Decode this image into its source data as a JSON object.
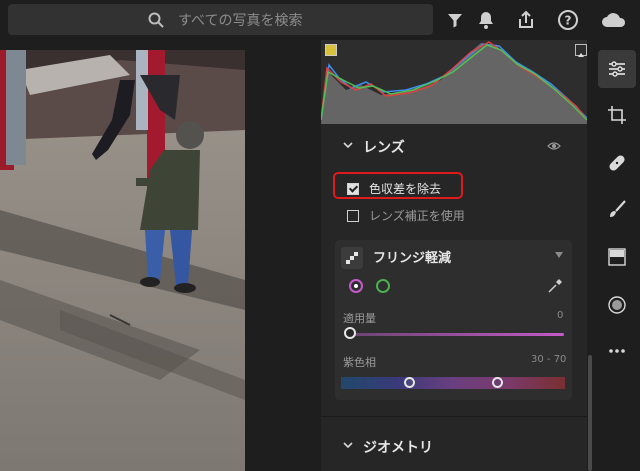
{
  "topbar": {
    "search_placeholder": "すべての写真を検索",
    "icons": [
      "search-icon",
      "filter-icon",
      "bell-icon",
      "share-icon",
      "help-icon",
      "cloud-icon"
    ]
  },
  "panel": {
    "lens_section": {
      "title": "レンズ",
      "remove_chromatic_aberration": {
        "label": "色収差を除去",
        "checked": true
      },
      "enable_profile_corrections": {
        "label": "レンズ補正を使用",
        "checked": false
      }
    },
    "defringe": {
      "title": "フリンジ軽減",
      "amount_label": "適用量",
      "amount_value": "0",
      "hue_label": "紫色相",
      "hue_value": "30 - 70"
    },
    "geometry_section": {
      "title": "ジオメトリ"
    }
  },
  "toolbar": {
    "tools": [
      "edit-sliders-icon",
      "crop-icon",
      "healing-icon",
      "brush-icon",
      "gradient-icon",
      "radial-icon",
      "more-icon"
    ]
  },
  "colors": {
    "highlight": "#e0191b",
    "purple": "#c45ac8",
    "green": "#4caf50"
  }
}
